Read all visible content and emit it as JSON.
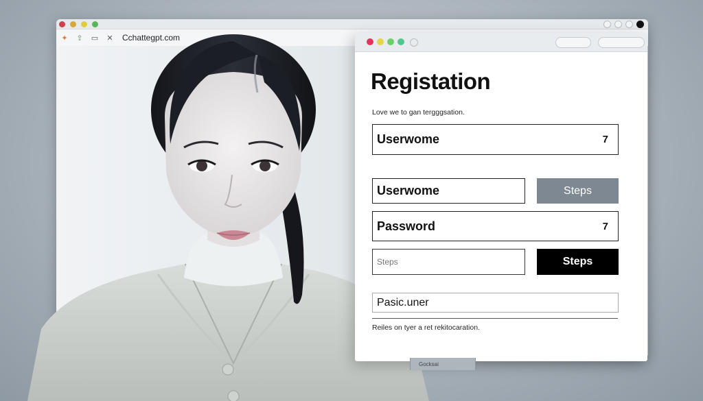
{
  "browser": {
    "address": "Cchattegpt.com",
    "traffic_colors": [
      "#d13f4e",
      "#d8a93a",
      "#e0cd3c",
      "#57b65b"
    ]
  },
  "registration": {
    "title": "Registation",
    "subtitle": "Love we to gan tergggsation.",
    "field1": {
      "value": "Userwome",
      "mark": "7"
    },
    "field2": {
      "value": "Userwome"
    },
    "button1_label": "Steps",
    "field3": {
      "value": "Password",
      "mark": "7"
    },
    "field4": {
      "placeholder": "Steps"
    },
    "button2_label": "Steps",
    "field5": {
      "value": "Pasic.uner"
    },
    "note": "Reiles on tyer a ret rekitocaration.",
    "traffic_colors": [
      "#e0365a",
      "#e3d64b",
      "#6ccf6a",
      "#58c58e"
    ]
  },
  "bottom_strip_text": "Gocksai"
}
